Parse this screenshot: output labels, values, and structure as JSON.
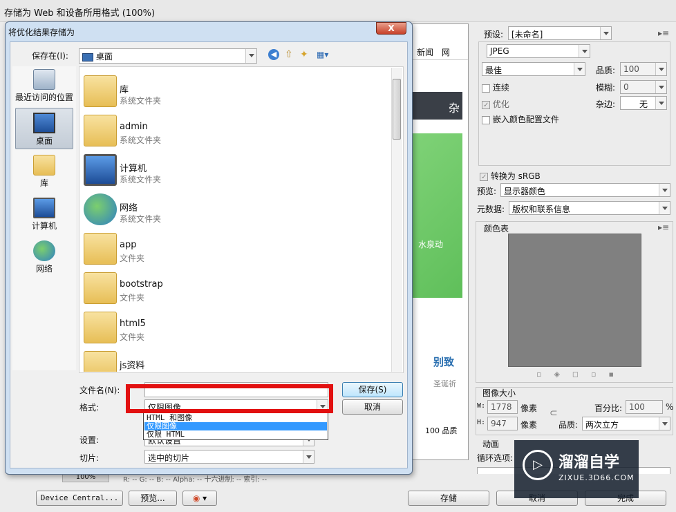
{
  "app": {
    "title": "存储为 Web 和设备所用格式 (100%)"
  },
  "background": {
    "tabs": [
      "新闻",
      "网"
    ],
    "text_snippets": [
      "杂",
      "水泉动",
      "别致",
      "圣诞祈",
      "100 品质"
    ]
  },
  "right_panel": {
    "preset_label": "预设:",
    "preset_value": "[未命名]",
    "format_value": "JPEG",
    "quality_preset": "最佳",
    "quality_label": "品质:",
    "quality_value": "100",
    "progressive_label": "连续",
    "blur_label": "模糊:",
    "blur_value": "0",
    "optimized_label": "优化",
    "matte_label": "杂边:",
    "matte_value": "无",
    "embed_profile_label": "嵌入颜色配置文件",
    "convert_srgb_label": "转换为 sRGB",
    "preview_label": "预览:",
    "preview_value": "显示器颜色",
    "metadata_label": "元数据:",
    "metadata_value": "版权和联系信息",
    "color_table_label": "颜色表",
    "image_size_label": "图像大小",
    "width_label": "W:",
    "width_value": "1778",
    "height_label": "H:",
    "height_value": "947",
    "pixel_unit": "像素",
    "percent_label": "百分比:",
    "percent_value": "100",
    "percent_unit": "%",
    "quality2_label": "品质:",
    "quality2_value": "两次立方",
    "animation_label": "动画",
    "loop_label": "循环选项:"
  },
  "bottom_bar": {
    "device_central": "Device Central...",
    "preview": "预览...",
    "save": "存储",
    "cancel": "取消",
    "done": "完成",
    "zoom": "100%",
    "status_text": "R: --   G: --   B: --   Alpha: --   十六进制: --   索引: --"
  },
  "dialog": {
    "title": "将优化结果存储为",
    "close": "X",
    "save_in_label": "保存在(I):",
    "save_in_value": "桌面",
    "places": [
      {
        "label": "最近访问的位置",
        "icon": "recent-places-icon"
      },
      {
        "label": "桌面",
        "icon": "desktop-icon"
      },
      {
        "label": "库",
        "icon": "libraries-icon"
      },
      {
        "label": "计算机",
        "icon": "computer-icon"
      },
      {
        "label": "网络",
        "icon": "network-icon"
      }
    ],
    "files": [
      {
        "name": "库",
        "type": "系统文件夹",
        "icon": "libraries-folder-icon"
      },
      {
        "name": "admin",
        "type": "系统文件夹",
        "icon": "user-folder-icon"
      },
      {
        "name": "计算机",
        "type": "系统文件夹",
        "icon": "computer-icon"
      },
      {
        "name": "网络",
        "type": "系统文件夹",
        "icon": "network-icon"
      },
      {
        "name": "app",
        "type": "文件夹",
        "icon": "folder-icon"
      },
      {
        "name": "bootstrap",
        "type": "文件夹",
        "icon": "folder-icon"
      },
      {
        "name": "html5",
        "type": "文件夹",
        "icon": "folder-icon"
      },
      {
        "name": "js资料",
        "type": "文件夹",
        "icon": "folder-icon"
      }
    ],
    "filename_label": "文件名(N):",
    "format_label": "格式:",
    "format_value": "仅限图像",
    "format_options": [
      "HTML 和图像",
      "仅限图像",
      "仅限 HTML"
    ],
    "format_selected": "仅限图像",
    "settings_label": "设置:",
    "settings_value": "默认设置",
    "slices_label": "切片:",
    "slices_value": "选中的切片",
    "save_button": "保存(S)",
    "cancel_button": "取消"
  },
  "watermark": {
    "brand": "溜溜自学",
    "url": "ZIXUE.3D66.COM"
  }
}
